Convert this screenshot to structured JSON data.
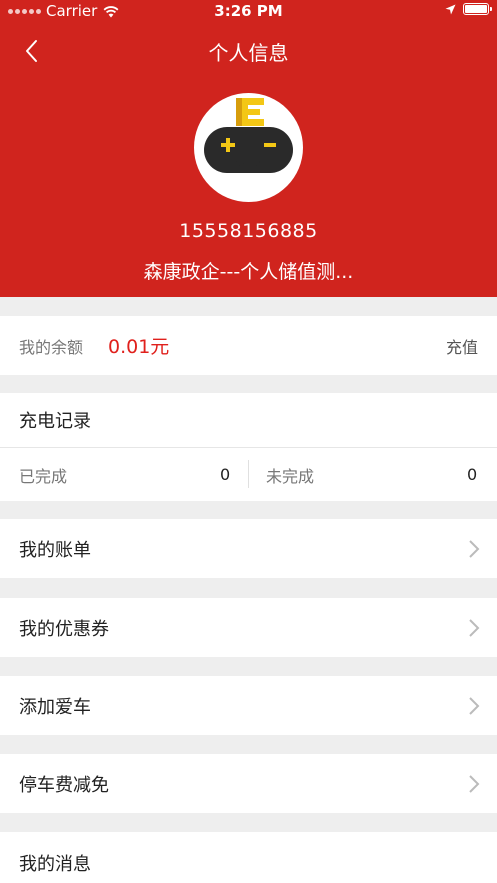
{
  "status_bar": {
    "carrier": "Carrier",
    "time": "3:26 PM"
  },
  "nav": {
    "title": "个人信息"
  },
  "profile": {
    "phone": "15558156885",
    "account_name": "森康政企---个人储值测..."
  },
  "balance": {
    "label": "我的余额",
    "value": "0.01元",
    "action": "充值"
  },
  "charge_records": {
    "title": "充电记录",
    "completed_label": "已完成",
    "completed_value": "0",
    "pending_label": "未完成",
    "pending_value": "0"
  },
  "menu": [
    {
      "label": "我的账单"
    },
    {
      "label": "我的优惠券"
    },
    {
      "label": "添加爱车"
    },
    {
      "label": "停车费减免"
    },
    {
      "label": "我的消息"
    }
  ],
  "colors": {
    "brand_red": "#d0241e",
    "balance_red": "#e0201c",
    "page_bg": "#eeeeee"
  },
  "icons": [
    "signal-dots-icon",
    "wifi-icon",
    "location-arrow-icon",
    "battery-icon",
    "back-arrow-icon",
    "gamepad-robot-avatar",
    "chevron-right-icon"
  ]
}
